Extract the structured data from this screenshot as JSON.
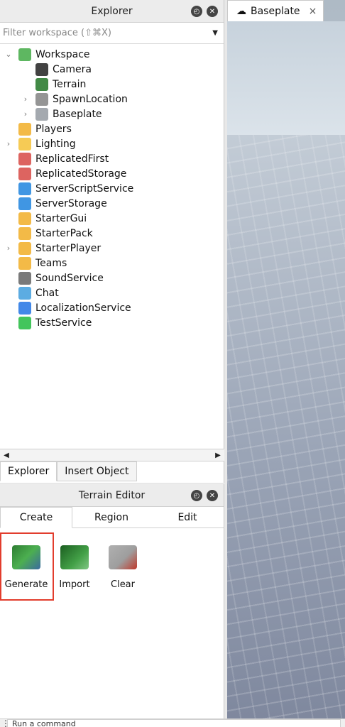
{
  "explorer": {
    "title": "Explorer",
    "filter_placeholder": "Filter workspace (⇧⌘X)",
    "items": [
      {
        "label": "Workspace",
        "indent": 0,
        "expandable": true,
        "expanded": true,
        "icon": "workspace-globe-icon",
        "color": "#4caf50"
      },
      {
        "label": "Camera",
        "indent": 1,
        "expandable": false,
        "icon": "camera-icon",
        "color": "#2d2d2d"
      },
      {
        "label": "Terrain",
        "indent": 1,
        "expandable": false,
        "icon": "terrain-icon",
        "color": "#2e7d32"
      },
      {
        "label": "SpawnLocation",
        "indent": 1,
        "expandable": true,
        "expanded": false,
        "icon": "spawn-location-icon",
        "color": "#8a8a8a"
      },
      {
        "label": "Baseplate",
        "indent": 1,
        "expandable": true,
        "expanded": false,
        "icon": "baseplate-icon",
        "color": "#9aa0a6"
      },
      {
        "label": "Players",
        "indent": 0,
        "expandable": false,
        "icon": "players-icon",
        "color": "#f2b233"
      },
      {
        "label": "Lighting",
        "indent": 0,
        "expandable": true,
        "expanded": false,
        "icon": "lighting-bulb-icon",
        "color": "#f5c542"
      },
      {
        "label": "ReplicatedFirst",
        "indent": 0,
        "expandable": false,
        "icon": "replicated-first-icon",
        "color": "#d9534f"
      },
      {
        "label": "ReplicatedStorage",
        "indent": 0,
        "expandable": false,
        "icon": "replicated-storage-icon",
        "color": "#d9534f"
      },
      {
        "label": "ServerScriptService",
        "indent": 0,
        "expandable": false,
        "icon": "server-script-service-icon",
        "color": "#2b8be0"
      },
      {
        "label": "ServerStorage",
        "indent": 0,
        "expandable": false,
        "icon": "server-storage-icon",
        "color": "#2b8be0"
      },
      {
        "label": "StarterGui",
        "indent": 0,
        "expandable": false,
        "icon": "starter-gui-icon",
        "color": "#f2b233"
      },
      {
        "label": "StarterPack",
        "indent": 0,
        "expandable": false,
        "icon": "starter-pack-icon",
        "color": "#f2b233"
      },
      {
        "label": "StarterPlayer",
        "indent": 0,
        "expandable": true,
        "expanded": false,
        "icon": "starter-player-icon",
        "color": "#f2b233"
      },
      {
        "label": "Teams",
        "indent": 0,
        "expandable": false,
        "icon": "teams-icon",
        "color": "#f2b233"
      },
      {
        "label": "SoundService",
        "indent": 0,
        "expandable": false,
        "icon": "sound-service-icon",
        "color": "#6b6b6b"
      },
      {
        "label": "Chat",
        "indent": 0,
        "expandable": false,
        "icon": "chat-icon",
        "color": "#4aa3df"
      },
      {
        "label": "LocalizationService",
        "indent": 0,
        "expandable": false,
        "icon": "localization-service-icon",
        "color": "#2d7be6"
      },
      {
        "label": "TestService",
        "indent": 0,
        "expandable": false,
        "icon": "test-service-icon",
        "color": "#2fbf4a"
      }
    ],
    "bottom_tabs": [
      {
        "label": "Explorer",
        "active": true
      },
      {
        "label": "Insert Object",
        "active": false
      }
    ]
  },
  "terrain_editor": {
    "title": "Terrain Editor",
    "tabs": [
      {
        "label": "Create",
        "active": true
      },
      {
        "label": "Region",
        "active": false
      },
      {
        "label": "Edit",
        "active": false
      }
    ],
    "tools": [
      {
        "label": "Generate",
        "icon": "generate-terrain-icon",
        "color": "#3b6aa0",
        "highlighted": true
      },
      {
        "label": "Import",
        "icon": "import-terrain-icon",
        "color": "#2e7d32",
        "highlighted": false
      },
      {
        "label": "Clear",
        "icon": "clear-terrain-icon",
        "color": "#c0392b",
        "highlighted": false
      }
    ]
  },
  "viewport": {
    "tab_label": "Baseplate",
    "tab_icon": "cloud-icon",
    "close_icon": "close-icon"
  },
  "command_bar": {
    "placeholder": "Run a command"
  },
  "colors": {
    "highlight": "#e23d2d"
  }
}
